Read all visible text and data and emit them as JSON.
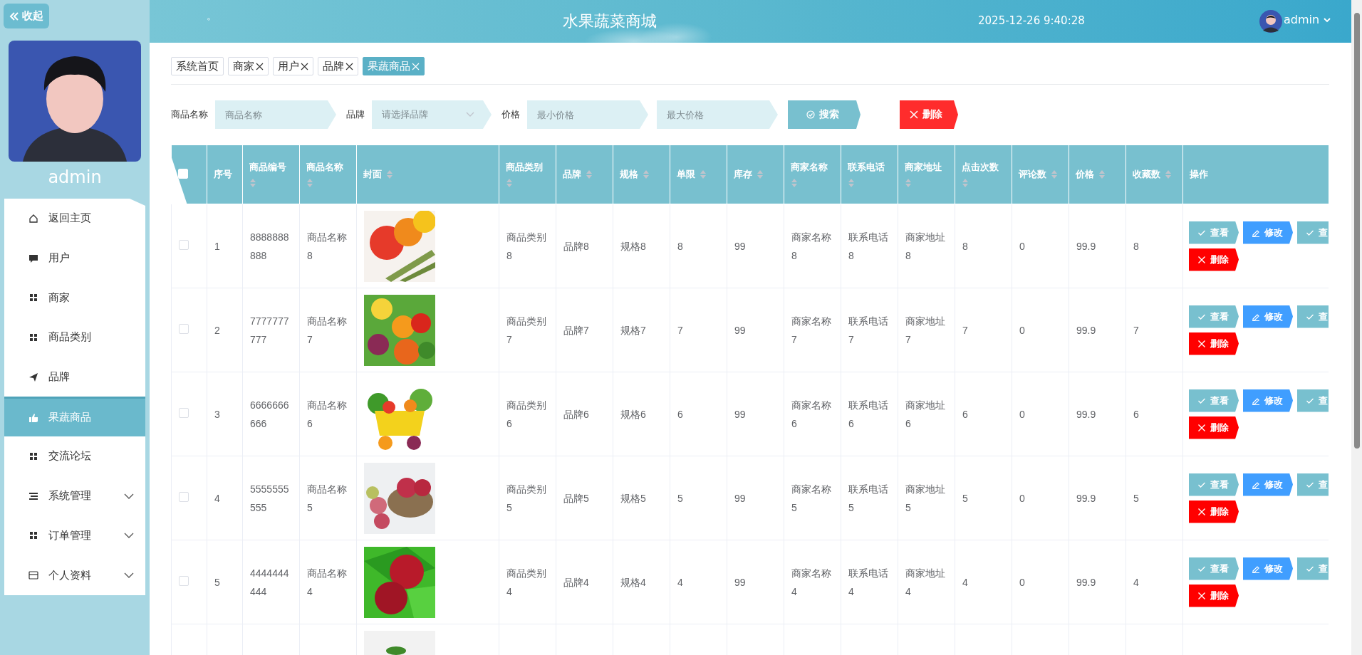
{
  "sidebar": {
    "collapse_label": "收起",
    "user_name": "admin",
    "menu": [
      {
        "label": "返回主页",
        "selected": false,
        "expandable": false
      },
      {
        "label": "用户",
        "selected": false,
        "expandable": false
      },
      {
        "label": "商家",
        "selected": false,
        "expandable": false
      },
      {
        "label": "商品类别",
        "selected": false,
        "expandable": false
      },
      {
        "label": "品牌",
        "selected": false,
        "expandable": false
      },
      {
        "label": "果蔬商品",
        "selected": true,
        "expandable": false
      },
      {
        "label": "交流论坛",
        "selected": false,
        "expandable": false
      },
      {
        "label": "系统管理",
        "selected": false,
        "expandable": true
      },
      {
        "label": "订单管理",
        "selected": false,
        "expandable": true
      },
      {
        "label": "个人资料",
        "selected": false,
        "expandable": true
      }
    ]
  },
  "header": {
    "mark": "。",
    "title": "水果蔬菜商城",
    "datetime": "2025-12-26 9:40:28",
    "user": "admin"
  },
  "tags": [
    {
      "label": "系统首页",
      "closable": false,
      "selected": false
    },
    {
      "label": "商家",
      "closable": true,
      "selected": false
    },
    {
      "label": "用户",
      "closable": true,
      "selected": false
    },
    {
      "label": "品牌",
      "closable": true,
      "selected": false
    },
    {
      "label": "果蔬商品",
      "closable": true,
      "selected": true
    }
  ],
  "filters": [
    {
      "label": "商品名称",
      "fields": [
        {
          "placeholder": "商品名称",
          "kind": "text"
        }
      ]
    },
    {
      "label": "品牌",
      "fields": [
        {
          "placeholder": "请选择品牌",
          "kind": "select"
        }
      ]
    },
    {
      "label": "价格",
      "fields": [
        {
          "placeholder": "最小价格",
          "kind": "text"
        },
        {
          "placeholder": "最大价格",
          "kind": "text"
        }
      ]
    }
  ],
  "search_button": "搜索",
  "delete_button": "删除",
  "table": {
    "select_all_checked": false,
    "columns": [
      {
        "label": "序号",
        "sortable": false
      },
      {
        "label": "商品编号",
        "sortable": true
      },
      {
        "label": "商品名称",
        "sortable": true
      },
      {
        "label": "封面",
        "sortable": true
      },
      {
        "label": "商品类别",
        "sortable": true
      },
      {
        "label": "品牌",
        "sortable": true
      },
      {
        "label": "规格",
        "sortable": true
      },
      {
        "label": "单限",
        "sortable": true
      },
      {
        "label": "库存",
        "sortable": true
      },
      {
        "label": "商家名称",
        "sortable": true
      },
      {
        "label": "联系电话",
        "sortable": true
      },
      {
        "label": "商家地址",
        "sortable": true
      },
      {
        "label": "点击次数",
        "sortable": true
      },
      {
        "label": "评论数",
        "sortable": true
      },
      {
        "label": "价格",
        "sortable": true
      },
      {
        "label": "收藏数",
        "sortable": true
      },
      {
        "label": "操作",
        "sortable": false
      }
    ],
    "rows": [
      {
        "checked": false,
        "cells": [
          "1",
          "8888888888",
          "商品名称8"
        ],
        "cover": {
          "kind": "picture"
        },
        "cells2": [
          "商品类别8",
          "品牌8",
          "规格8",
          "8",
          "99",
          "商家名称8",
          "联系电话8",
          "商家地址8",
          "8",
          "0",
          "99.9",
          "8"
        ],
        "actions": [
          {
            "label": "查看",
            "kind": "view"
          },
          {
            "label": "修改",
            "kind": "edit"
          },
          {
            "label": "查",
            "kind": "view"
          },
          {
            "label": "删除",
            "kind": "delete"
          }
        ]
      },
      {
        "checked": false,
        "cells": [
          "2",
          "7777777777",
          "商品名称7"
        ],
        "cover": {
          "kind": "picture"
        },
        "cells2": [
          "商品类别7",
          "品牌7",
          "规格7",
          "7",
          "99",
          "商家名称7",
          "联系电话7",
          "商家地址7",
          "7",
          "0",
          "99.9",
          "7"
        ],
        "actions": [
          {
            "label": "查看",
            "kind": "view"
          },
          {
            "label": "修改",
            "kind": "edit"
          },
          {
            "label": "查",
            "kind": "view"
          },
          {
            "label": "删除",
            "kind": "delete"
          }
        ]
      },
      {
        "checked": false,
        "cells": [
          "3",
          "6666666666",
          "商品名称6"
        ],
        "cover": {
          "kind": "picture"
        },
        "cells2": [
          "商品类别6",
          "品牌6",
          "规格6",
          "6",
          "99",
          "商家名称6",
          "联系电话6",
          "商家地址6",
          "6",
          "0",
          "99.9",
          "6"
        ],
        "actions": [
          {
            "label": "查看",
            "kind": "view"
          },
          {
            "label": "修改",
            "kind": "edit"
          },
          {
            "label": "查",
            "kind": "view"
          },
          {
            "label": "删除",
            "kind": "delete"
          }
        ]
      },
      {
        "checked": false,
        "cells": [
          "4",
          "5555555555",
          "商品名称5"
        ],
        "cover": {
          "kind": "picture"
        },
        "cells2": [
          "商品类别5",
          "品牌5",
          "规格5",
          "5",
          "99",
          "商家名称5",
          "联系电话5",
          "商家地址5",
          "5",
          "0",
          "99.9",
          "5"
        ],
        "actions": [
          {
            "label": "查看",
            "kind": "view"
          },
          {
            "label": "修改",
            "kind": "edit"
          },
          {
            "label": "查",
            "kind": "view"
          },
          {
            "label": "删除",
            "kind": "delete"
          }
        ]
      },
      {
        "checked": false,
        "cells": [
          "5",
          "4444444444",
          "商品名称4"
        ],
        "cover": {
          "kind": "picture"
        },
        "cells2": [
          "商品类别4",
          "品牌4",
          "规格4",
          "4",
          "99",
          "商家名称4",
          "联系电话4",
          "商家地址4",
          "4",
          "0",
          "99.9",
          "4"
        ],
        "actions": [
          {
            "label": "查看",
            "kind": "view"
          },
          {
            "label": "修改",
            "kind": "edit"
          },
          {
            "label": "查",
            "kind": "view"
          },
          {
            "label": "删除",
            "kind": "delete"
          }
        ]
      },
      {
        "cover": {
          "kind": "picture"
        }
      }
    ]
  }
}
